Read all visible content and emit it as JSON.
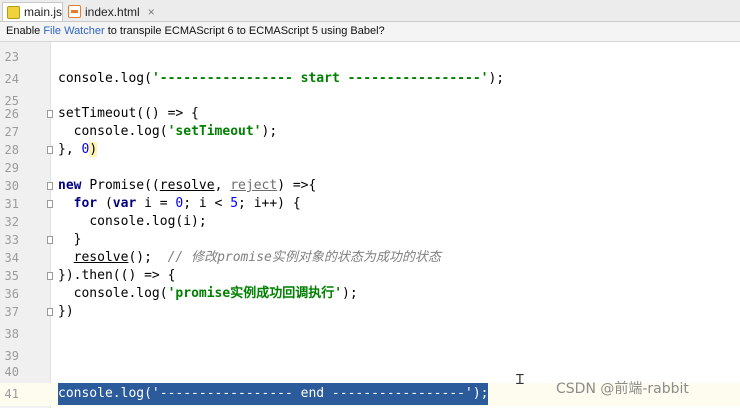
{
  "tabs": [
    {
      "label": "main.js",
      "close": "×",
      "icon": "js-file-icon"
    },
    {
      "label": "index.html",
      "close": "×",
      "icon": "html-file-icon"
    }
  ],
  "banner": {
    "prefix": "Enable ",
    "link": "File Watcher",
    "suffix": " to transpile ECMAScript 6 to ECMAScript 5 using Babel?"
  },
  "lines": [
    {
      "n": "23"
    },
    {
      "n": "24",
      "console": "console",
      "log": ".log(",
      "str": "'----------------- start -----------------'",
      "end": ");"
    },
    {
      "n": "25"
    },
    {
      "n": "26",
      "a": "setTimeout(() => {"
    },
    {
      "n": "27",
      "ind": "  ",
      "console": "console",
      "log": ".log(",
      "str": "'setTimeout'",
      "end": ");"
    },
    {
      "n": "28",
      "a": "}, ",
      "num": "0",
      "b": ")"
    },
    {
      "n": "29"
    },
    {
      "n": "30",
      "kw": "new ",
      "a": "Promise((",
      "p1": "resolve",
      "sep": ", ",
      "p2": "reject",
      "b": ") =>{"
    },
    {
      "n": "31",
      "ind": "  ",
      "kw": "for",
      "a": " (",
      "kw2": "var",
      "b": " i = ",
      "num": "0",
      "c": "; i < ",
      "num2": "5",
      "d": "; i++) {"
    },
    {
      "n": "32",
      "ind": "    ",
      "a": "console.log(i);"
    },
    {
      "n": "33",
      "a": "  }"
    },
    {
      "n": "34",
      "ind": "  ",
      "p1": "resolve",
      "a": "();  ",
      "comment": "// 修改promise实例对象的状态为成功的状态"
    },
    {
      "n": "35",
      "a": "}).then(() => {"
    },
    {
      "n": "36",
      "ind": "  ",
      "console": "console",
      "log": ".log(",
      "str": "'promise实例成功回调执行'",
      "end": ");"
    },
    {
      "n": "37",
      "a": "})"
    },
    {
      "n": "38"
    },
    {
      "n": "39"
    },
    {
      "n": "40"
    },
    {
      "n": "41",
      "a": "console.log('----------------- end -----------------');"
    }
  ],
  "watermark": "CSDN @前端-rabbit"
}
